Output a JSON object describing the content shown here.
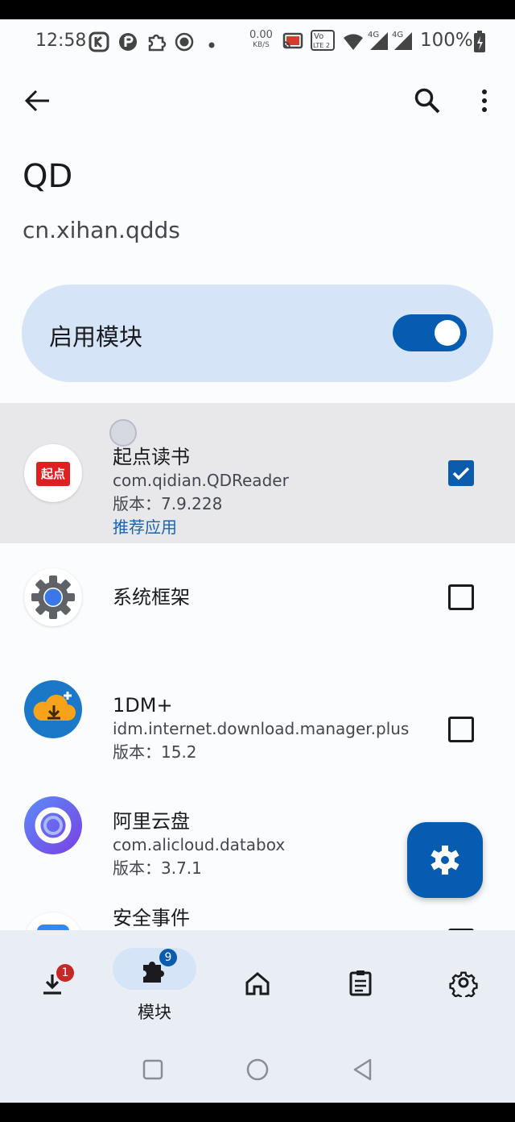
{
  "status_bar": {
    "time": "12:58",
    "net_rate_value": "0.00",
    "net_rate_unit": "KB/S",
    "volte_label_top": "Vo",
    "volte_label_bottom": "LTE 2",
    "signal_1_label": "4G",
    "signal_2_label": "4G",
    "battery_percent": "100%"
  },
  "top_bar": {
    "back_icon": "arrow-back-icon",
    "search_icon": "search-icon",
    "more_icon": "more-vert-icon"
  },
  "header": {
    "title": "QD",
    "package": "cn.xihan.qdds"
  },
  "enable_module": {
    "label": "启用模块",
    "enabled": true
  },
  "scope_list": [
    {
      "name": "起点读书",
      "package": "com.qidian.QDReader",
      "version": "版本：7.9.228",
      "tag": "推荐应用",
      "checked": true,
      "icon_text": "起点"
    },
    {
      "name": "系统框架",
      "checked": false
    },
    {
      "name": "1DM+",
      "package": "idm.internet.download.manager.plus",
      "version": "版本：15.2",
      "checked": false
    },
    {
      "name": "阿里云盘",
      "package": "com.alicloud.databox",
      "version": "版本：3.7.1",
      "checked": false
    },
    {
      "name": "安全事件",
      "checked": false
    }
  ],
  "fab": {
    "icon": "settings-icon"
  },
  "bottom_nav": {
    "items": [
      {
        "icon": "download-icon",
        "badge": "1"
      },
      {
        "icon": "extension-icon",
        "badge": "9",
        "label": "模块",
        "selected": true
      },
      {
        "icon": "home-icon"
      },
      {
        "icon": "clipboard-icon"
      },
      {
        "icon": "settings-icon"
      }
    ]
  },
  "colors": {
    "accent": "#065cb0",
    "card_bg": "#d6e4f8",
    "link": "#1a63ad",
    "badge_red": "#c62828",
    "badge_blue": "#0b5cad",
    "qidian_red": "#e02020"
  }
}
